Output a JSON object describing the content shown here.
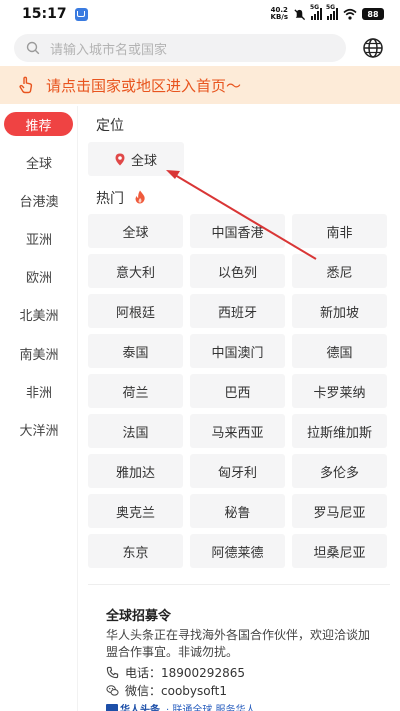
{
  "status": {
    "time": "15:17",
    "net_speed_value": "40.2",
    "net_speed_unit": "KB/s",
    "signal_label_1": "5G",
    "signal_label_2": "5G",
    "battery": "88"
  },
  "search": {
    "placeholder": "请输入城市名或国家"
  },
  "notice": {
    "text": "请点击国家或地区进入首页～"
  },
  "sidebar": {
    "items": [
      {
        "label": "推荐",
        "active": true
      },
      {
        "label": "全球"
      },
      {
        "label": "台港澳"
      },
      {
        "label": "亚洲"
      },
      {
        "label": "欧洲"
      },
      {
        "label": "北美洲"
      },
      {
        "label": "南美洲"
      },
      {
        "label": "非洲"
      },
      {
        "label": "大洋洲"
      }
    ]
  },
  "location": {
    "title": "定位",
    "current": "全球"
  },
  "hot": {
    "title": "热门",
    "places": [
      "全球",
      "中国香港",
      "南非",
      "意大利",
      "以色列",
      "悉尼",
      "阿根廷",
      "西班牙",
      "新加坡",
      "泰国",
      "中国澳门",
      "德国",
      "荷兰",
      "巴西",
      "卡罗莱纳",
      "法国",
      "马来西亚",
      "拉斯维加斯",
      "雅加达",
      "匈牙利",
      "多伦多",
      "奥克兰",
      "秘鲁",
      "罗马尼亚",
      "东京",
      "阿德莱德",
      "坦桑尼亚"
    ]
  },
  "recruit": {
    "title": "全球招募令",
    "description": "华人头条正在寻找海外各国合作伙伴，欢迎洽谈加盟合作事宜。非诚勿扰。",
    "phone": "电话：18900292865",
    "wechat": "微信：coobysoft1",
    "brand": "华人头条",
    "slogan": "· 联通全球 服务华人"
  },
  "colors": {
    "accent": "#ef4343",
    "notice_bg": "#fdebd8",
    "notice_text": "#e8541e",
    "annotation_arrow": "#d93636"
  }
}
